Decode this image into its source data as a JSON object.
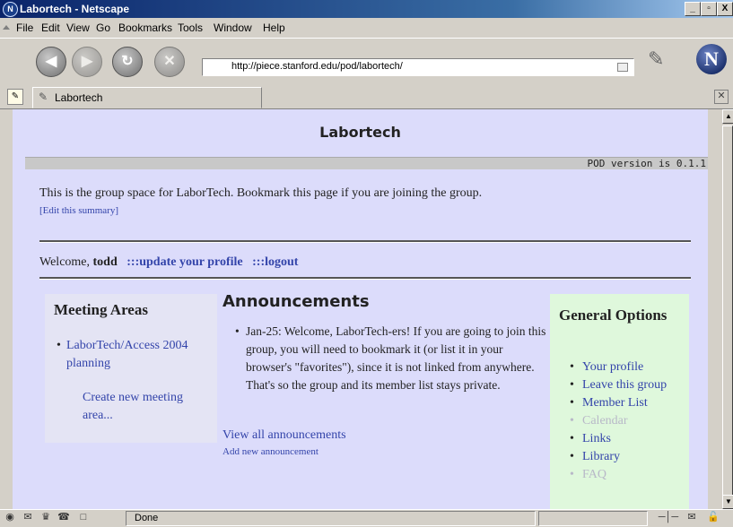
{
  "window": {
    "title": "Labortech - Netscape",
    "controls": {
      "minimize": "_",
      "maximize": "▫",
      "close": "X"
    }
  },
  "menu": [
    "File",
    "Edit",
    "View",
    "Go",
    "Bookmarks",
    "Tools",
    "Window",
    "Help"
  ],
  "nav": {
    "url": "http://piece.stanford.edu/pod/labortech/",
    "back_icon": "◀",
    "forward_icon": "▶",
    "reload_icon": "↻",
    "stop_icon": "✕",
    "logo": "N"
  },
  "tab": {
    "label": "Labortech"
  },
  "page": {
    "title": "Labortech",
    "version": "POD version is 0.1.1",
    "summary": "This is the group space for LaborTech. Bookmark this page if you are joining the group.",
    "edit_summary": "[Edit this summary]",
    "welcome_prefix": "Welcome,",
    "user": "todd",
    "update_profile": ":::update your profile",
    "logout": ":::logout"
  },
  "meeting_areas": {
    "heading": "Meeting Areas",
    "items": [
      "LaborTech/Access 2004 planning"
    ],
    "create": "Create new meeting area..."
  },
  "announcements": {
    "heading": "Announcements",
    "items": [
      "Jan-25: Welcome, LaborTech-ers! If you are going to join this group, you will need to bookmark it (or list it in your browser's \"favorites\"), since it is not linked from anywhere. That's so the group and its member list stays private."
    ],
    "view_all": "View all announcements",
    "add_new": "Add new announcement"
  },
  "general_options": {
    "heading": "General Options",
    "items": [
      {
        "label": "Your profile",
        "enabled": true
      },
      {
        "label": "Leave this group",
        "enabled": true
      },
      {
        "label": "Member List",
        "enabled": true
      },
      {
        "label": "Calendar",
        "enabled": false
      },
      {
        "label": "Links",
        "enabled": true
      },
      {
        "label": "Library",
        "enabled": true
      },
      {
        "label": "FAQ",
        "enabled": false
      }
    ]
  },
  "status": {
    "text": "Done"
  }
}
